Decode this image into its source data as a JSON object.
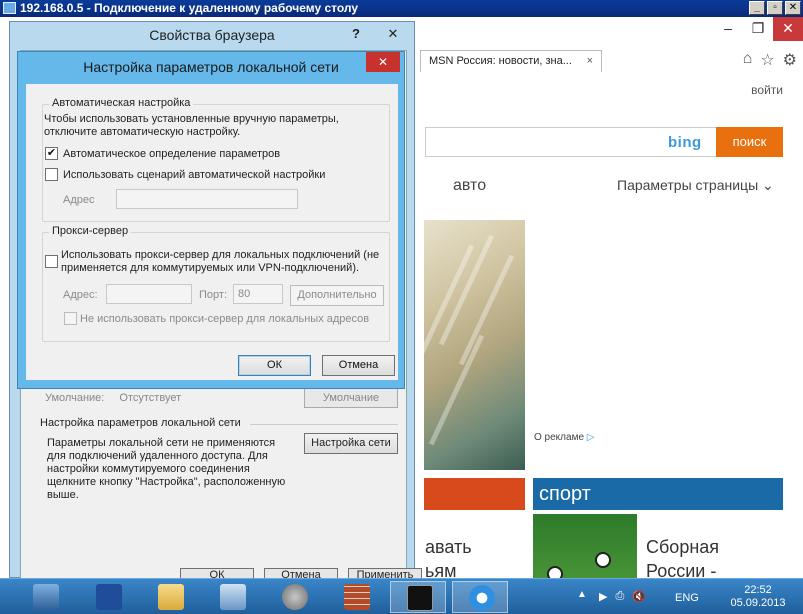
{
  "rdp": {
    "title": "192.168.0.5 - Подключение к удаленному рабочему столу",
    "buttons": [
      "_",
      "▫",
      "✕"
    ]
  },
  "ie": {
    "tab_title": "MSN Россия: новости, зна...",
    "tab_close": "×",
    "window_buttons": [
      "–",
      "❐",
      "✕"
    ],
    "toolbar_icons": [
      "⌂",
      "☆",
      "⚙"
    ],
    "login": "войти",
    "bing_logo": "bing",
    "search_button": "поиск",
    "nav_auto": "авто",
    "page_params": "Параметры страницы",
    "page_params_chevron": "⌄",
    "ad_about": "О рекламе",
    "ad_icon": "▷",
    "sport_header": "спорт",
    "sport_headline": "Сборная России - чемпион",
    "left_headline": "авать ьям вать"
  },
  "props": {
    "title": "Свойства браузера",
    "help": "?",
    "close": "✕",
    "default_label": "Умолчание:",
    "default_value": "Отсутствует",
    "default_button": "Умолчание",
    "lan_section_title": "Настройка параметров локальной сети",
    "lan_description": "Параметры локальной сети не применяются для подключений удаленного доступа. Для настройки коммутируемого соединения щелкните кнопку \"Настройка\", расположенную выше.",
    "net_settings_button": "Настройка сети",
    "bottom_buttons": [
      "ОК",
      "Отмена",
      "Применить"
    ]
  },
  "lan": {
    "title": "Настройка параметров локальной сети",
    "close": "✕",
    "auto_group_title": "Автоматическая настройка",
    "auto_desc": "Чтобы использовать установленные вручную параметры, отключите автоматическую настройку.",
    "auto_detect_label": "Автоматическое определение параметров",
    "auto_detect_checked": "✔",
    "use_script_label": "Использовать сценарий автоматической настройки",
    "address_label": "Адрес",
    "address_value": "",
    "proxy_group_title": "Прокси-сервер",
    "use_proxy_label": "Использовать прокси-сервер для локальных подключений (не применяется для коммутируемых или VPN-подключений).",
    "proxy_address_label": "Адрес:",
    "proxy_address_value": "",
    "port_label": "Порт:",
    "port_value": "80",
    "advanced_button": "Дополнительно",
    "bypass_label": "Не использовать прокси-сервер для локальных адресов",
    "ok_button": "ОК",
    "cancel_button": "Отмена"
  },
  "taskbar": {
    "items": [
      "server-manager",
      "powershell",
      "file-explorer",
      "control-panel",
      "settings",
      "firewall",
      "cmd",
      "internet-explorer"
    ],
    "tray_arrow": "▲",
    "tray_icons": [
      "▶",
      "⎙",
      "🔇"
    ],
    "lang": "ENG",
    "time": "22:52",
    "date": "05.09.2013"
  },
  "colors": {
    "search_orange": "#e8700f",
    "sport_blue": "#1a6aa8",
    "close_red": "#c7312e",
    "dialog_frame": "#64b8ea"
  }
}
